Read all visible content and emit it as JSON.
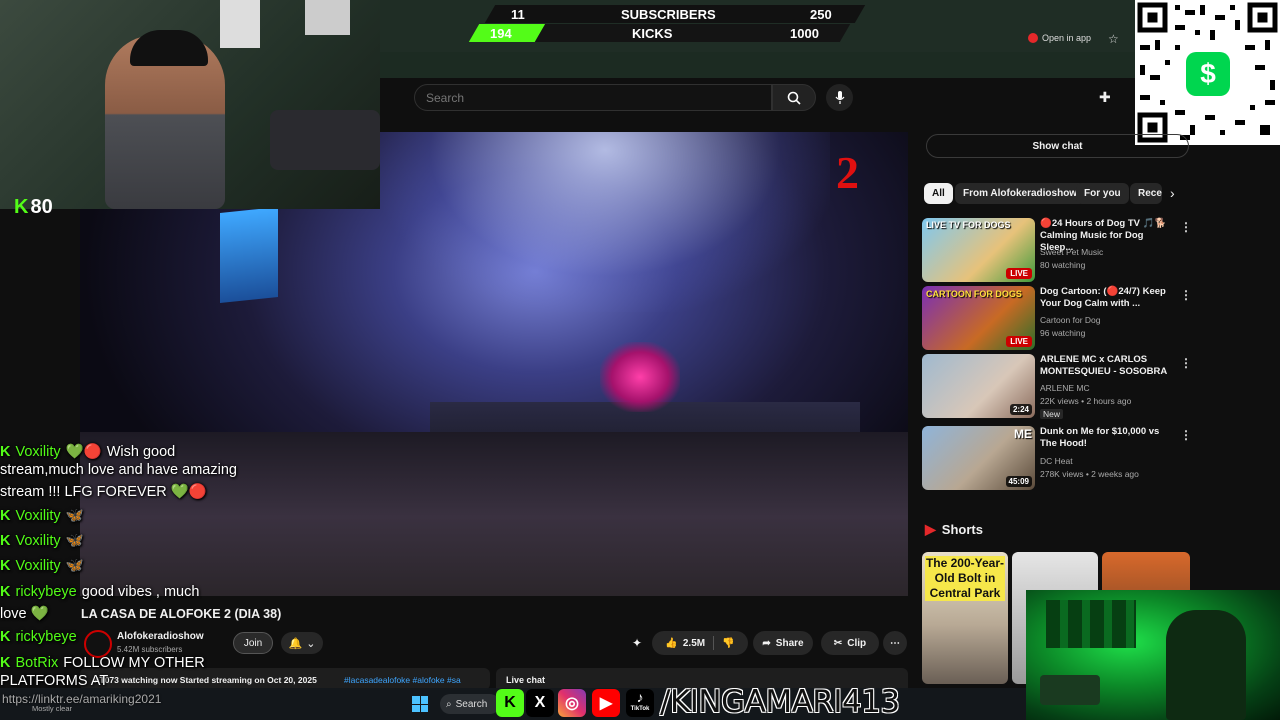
{
  "overlay": {
    "stats_top": {
      "current": "11",
      "label": "SUBSCRIBERS",
      "goal": "250"
    },
    "stats_bottom": {
      "current": "194",
      "label": "KICKS",
      "goal": "1000"
    },
    "kick_count": "80",
    "open_in_app": "Open in app",
    "handle": "/KINGAMARI413",
    "link_text": "https://linktr.ee/amariking2021",
    "accent_color": "#53fc18",
    "num_badge": "2"
  },
  "search": {
    "placeholder": "Search"
  },
  "sidebar": {
    "show_chat": "Show chat",
    "chips": [
      "All",
      "From Alofokeradioshow",
      "For you",
      "Rece"
    ],
    "recs": [
      {
        "title": "🔴24 Hours of Dog TV 🎵🐕 Calming Music for Dog Sleep...",
        "channel": "Sweet Pet Music",
        "meta": "80 watching",
        "badge": "LIVE",
        "thumb_text": "LIVE TV FOR DOGS"
      },
      {
        "title": "Dog Cartoon: (🔴24/7) Keep Your Dog Calm with ...",
        "channel": "Cartoon for Dog",
        "meta": "96 watching",
        "badge": "LIVE",
        "thumb_text": "CARTOON FOR DOGS"
      },
      {
        "title": "ARLENE MC x CARLOS MONTESQUIEU - SOSOBRA",
        "channel": "ARLENE MC",
        "meta": "22K views • 2 hours ago",
        "extra": "New",
        "duration": "2:24"
      },
      {
        "title": "Dunk on Me for $10,000 vs The Hood!",
        "channel": "DC Heat",
        "meta": "278K views • 2 weeks ago",
        "duration": "45:09",
        "thumb_text": "ME"
      }
    ],
    "shorts_label": "Shorts",
    "short_text": "The 200-Year-Old Bolt in Central Park"
  },
  "video": {
    "title": "LA CASA DE ALOFOKE 2 (DIA 38)",
    "channel": "Alofokeradioshow",
    "subs": "5.42M subscribers",
    "join": "Join",
    "likes": "2.5M",
    "share": "Share",
    "clip": "Clip",
    "watching": "AT073 watching now  Started streaming on Oct 20, 2025",
    "hashtags": "#lacasadealofoke #alofoke #sa",
    "live_chat": "Live chat"
  },
  "chat": [
    {
      "user": "Voxility",
      "text": "Wish good"
    },
    {
      "user": "",
      "text": "stream,much love and have amazing"
    },
    {
      "user": "",
      "text": "stream !!! LFG FOREVER 💚🔴"
    },
    {
      "user": "Voxility",
      "text": "🦋"
    },
    {
      "user": "Voxility",
      "text": "🦋"
    },
    {
      "user": "Voxility",
      "text": "🦋"
    },
    {
      "user": "rickybeye",
      "text": "good vibes , much"
    },
    {
      "user": "",
      "text": "love 💚"
    },
    {
      "user": "rickybeye",
      "text": ""
    },
    {
      "user": "BotRix",
      "text": "FOLLOW MY OTHER"
    },
    {
      "user": "",
      "text": "PLATFORMS AT"
    }
  ],
  "taskbar": {
    "search": "Search",
    "weather": "Mostly clear",
    "tiktok": "TikTok"
  }
}
